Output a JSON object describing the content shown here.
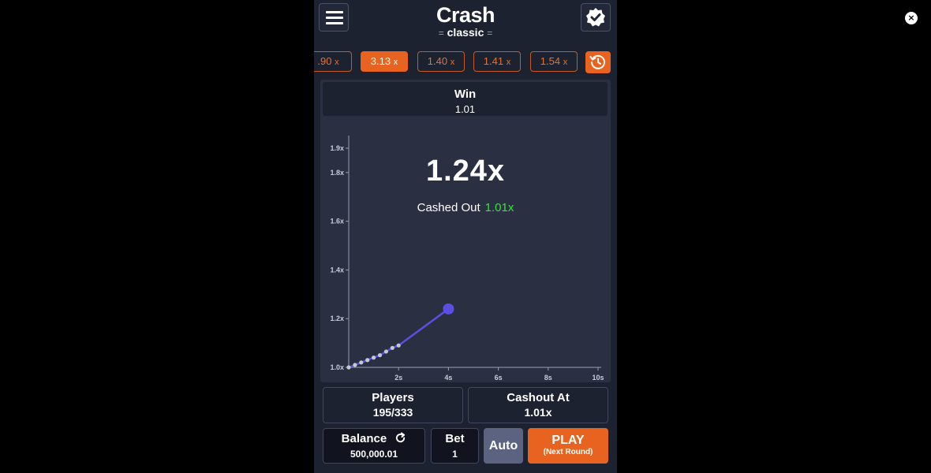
{
  "header": {
    "title": "Crash",
    "subtitle": "classic",
    "menu_icon": "hamburger-icon",
    "badge_icon": "verified-badge-icon"
  },
  "history": {
    "chips": [
      {
        "value": ".90",
        "unit": "x",
        "active": false
      },
      {
        "value": "3.13",
        "unit": "x",
        "active": true
      },
      {
        "value": "1.40",
        "unit": "x",
        "active": false
      },
      {
        "value": "1.41",
        "unit": "x",
        "active": false
      },
      {
        "value": "1.54",
        "unit": "x",
        "active": false
      }
    ],
    "history_icon": "clock-history-icon"
  },
  "win": {
    "label": "Win",
    "value": "1.01"
  },
  "game": {
    "multiplier": "1.24x",
    "cashed_out_label": "Cashed Out",
    "cashed_out_value": "1.01x"
  },
  "chart_data": {
    "type": "line",
    "x": [
      0.0,
      0.25,
      0.5,
      0.75,
      1.0,
      1.25,
      1.5,
      1.75,
      2.0,
      4.0
    ],
    "y": [
      1.0,
      1.01,
      1.02,
      1.03,
      1.04,
      1.05,
      1.065,
      1.08,
      1.09,
      1.24
    ],
    "cashout_points_x": [
      0.0,
      0.25,
      0.5,
      0.75,
      1.0,
      1.25,
      1.5,
      1.75,
      2.0
    ],
    "current_point": {
      "x": 4.0,
      "y": 1.24
    },
    "xticks": [
      "2s",
      "4s",
      "6s",
      "8s",
      "10s"
    ],
    "xtick_values": [
      2,
      4,
      6,
      8,
      10
    ],
    "yticks": [
      "1.0x",
      "1.2x",
      "1.4x",
      "1.6x",
      "1.8x",
      "1.9x"
    ],
    "ytick_values": [
      1.0,
      1.2,
      1.4,
      1.6,
      1.8,
      1.9
    ],
    "xlim": [
      0,
      10
    ],
    "ylim": [
      1.0,
      1.9
    ],
    "colors": {
      "line": "#5b4fe0",
      "dots": "#c8c8d0",
      "axis": "#9aa0b4"
    }
  },
  "stats": {
    "players_label": "Players",
    "players_value": "195/333",
    "cashout_label": "Cashout At",
    "cashout_value": "1.01x"
  },
  "controls": {
    "balance_label": "Balance",
    "balance_value": "500,000.01",
    "refresh_icon": "refresh-icon",
    "bet_label": "Bet",
    "bet_value": "1",
    "auto_label": "Auto",
    "play_label": "PLAY",
    "play_sub": "(Next Round)"
  },
  "overlay": {
    "close_icon": "close-icon",
    "close_glyph": "×"
  },
  "colors": {
    "accent": "#e8631f",
    "background": "#1d2231",
    "panel": "#2a2f42",
    "cashed_green": "#3ee03e"
  }
}
